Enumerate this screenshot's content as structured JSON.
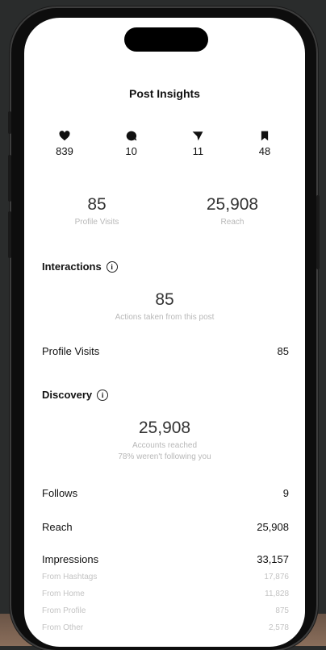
{
  "header": {
    "title": "Post Insights"
  },
  "engagement": [
    {
      "icon": "heart-icon",
      "value": "839"
    },
    {
      "icon": "comment-icon",
      "value": "10"
    },
    {
      "icon": "share-icon",
      "value": "11"
    },
    {
      "icon": "bookmark-icon",
      "value": "48"
    }
  ],
  "summary": {
    "profile_visits": {
      "value": "85",
      "label": "Profile Visits"
    },
    "reach": {
      "value": "25,908",
      "label": "Reach"
    }
  },
  "interactions": {
    "heading": "Interactions",
    "total": "85",
    "caption": "Actions taken from this post",
    "rows": [
      {
        "label": "Profile Visits",
        "value": "85"
      }
    ]
  },
  "discovery": {
    "heading": "Discovery",
    "total": "25,908",
    "caption": "Accounts reached",
    "caption2": "78% weren't following you",
    "follows": {
      "label": "Follows",
      "value": "9"
    },
    "reach": {
      "label": "Reach",
      "value": "25,908"
    },
    "impressions": {
      "label": "Impressions",
      "value": "33,157"
    },
    "breakdown": [
      {
        "label": "From Hashtags",
        "value": "17,876"
      },
      {
        "label": "From Home",
        "value": "11,828"
      },
      {
        "label": "From Profile",
        "value": "875"
      },
      {
        "label": "From Other",
        "value": "2,578"
      }
    ]
  }
}
